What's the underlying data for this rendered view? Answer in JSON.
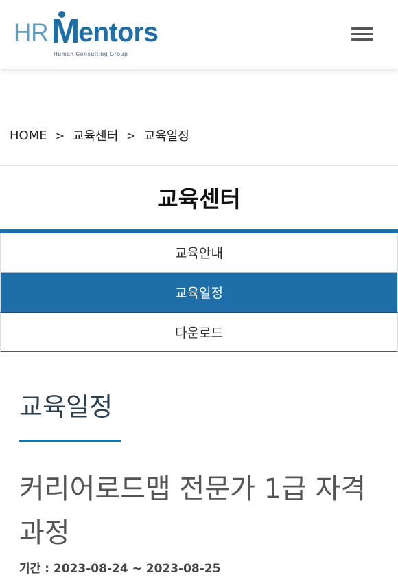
{
  "header": {
    "logo": {
      "hr": "HR",
      "m": "M",
      "rest": "entors",
      "subtitle": "Human Consulting Group"
    },
    "menu_icon": "hamburger-menu-icon"
  },
  "breadcrumb": {
    "items": [
      "HOME",
      "교육센터",
      "교육일정"
    ],
    "separator": ">"
  },
  "section": {
    "title": "교육센터"
  },
  "submenu": {
    "items": [
      {
        "label": "교육안내",
        "active": false
      },
      {
        "label": "교육일정",
        "active": true
      },
      {
        "label": "다운로드",
        "active": false
      }
    ]
  },
  "content": {
    "heading": "교육일정",
    "course_title": "커리어로드맵 전문가 1급 자격과정",
    "period": "기간 : 2023-08-24 ~ 2023-08-25"
  },
  "colors": {
    "brand_blue": "#1e6fa8",
    "logo_light_blue": "#5b9cc0"
  }
}
